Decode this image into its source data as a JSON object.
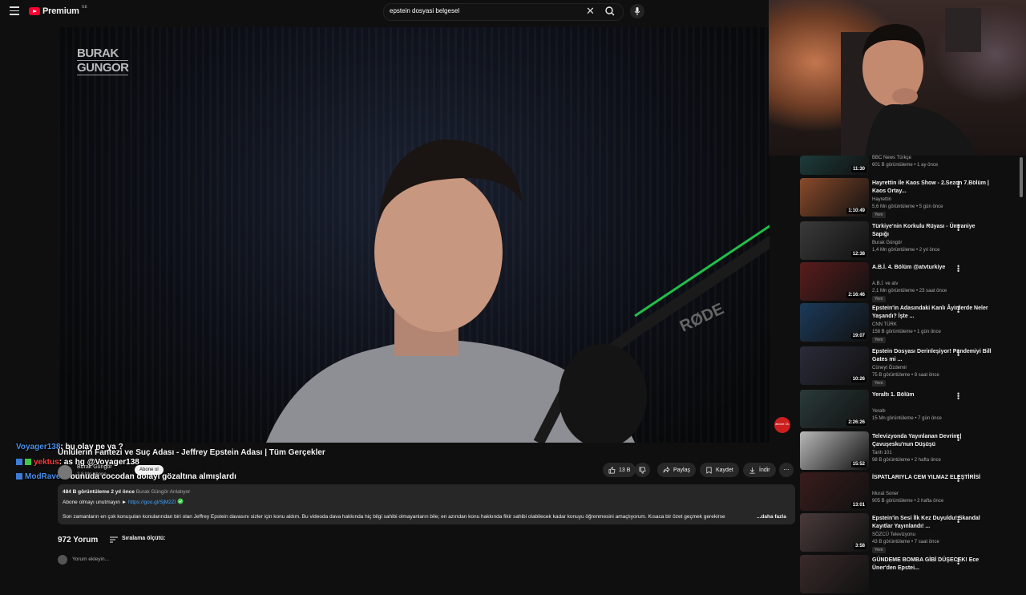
{
  "header": {
    "logo_text": "Premium",
    "logo_badge": "GE",
    "search_query": "epstein dosyasi belgesel",
    "icons": [
      "menu-icon",
      "youtube-logo-icon",
      "clear-icon",
      "search-icon",
      "mic-icon"
    ]
  },
  "player": {
    "watermark_line1": "BURAK",
    "watermark_line2": "GUNGOR",
    "overlay_badge": "abone OL"
  },
  "chat": [
    {
      "user": "Voyager138",
      "message": ": bu olay ne ya ?",
      "color": "#4a8fe7"
    },
    {
      "user": "yektus",
      "message": ": as hg @Voyager138",
      "color": "#ff3b3b"
    },
    {
      "user": "ModRaven",
      "message": ": bunuda cocodan dolayı gözaltına almışlardı",
      "color": "#4a8fe7"
    }
  ],
  "video": {
    "title": "Ünlülerin Fantezi ve Suç Adası - Jeffrey Epstein Adası | Tüm Gerçekler",
    "channel": "Burak Güngör",
    "subscribers": "2,8 Mn abone",
    "subscribe_label": "Abone ol",
    "likes": "13 B",
    "share_label": "Paylaş",
    "save_label": "Kaydet",
    "download_label": "İndir"
  },
  "description": {
    "views_date": "484 B görüntüleme  2 yıl önce",
    "hashtag": "Burak Güngör Anlatıyor",
    "subscribe_reminder": "Abone olmayı unutmayın ► ",
    "link": "https://goo.gl/SjM2ZI",
    "text": "Son zamanların en çok konuşulan konularından biri olan Jeffrey Epstein davasını sizler için konu aldım. Bu videoda dava hakkında hiç bilgi sahibi olmayanların bile; en azından konu hakkında fikir sahibi olabilecek kadar konuyu öğrenmesini amaçlıyorum. Kısaca bir özet geçmek gerekirse",
    "more_label": "...daha fazla"
  },
  "comments": {
    "count": "972 Yorum",
    "sort_label": "Sıralama ölçütü:",
    "input_placeholder": "Yorum ekleyin..."
  },
  "sidebar": {
    "items": [
      {
        "title": "",
        "channel": "BBC News Türkçe",
        "meta": "601 B görüntüleme • 1 ay önce",
        "badge": "",
        "duration": "11:30",
        "thumb": "#1d3b3a"
      },
      {
        "title": "Hayrettin ile Kaos Show - 2.Sezon 7.Bölüm | Kaos Ortay...",
        "channel": "Hayrettin",
        "meta": "5,6 Mn görüntüleme • 5 gün önce",
        "badge": "Yeni",
        "duration": "1:10:49",
        "thumb": "#8a4a2a"
      },
      {
        "title": "Türkiye'nin Korkulu Rüyası - Ümraniye Sapığı",
        "channel": "Burak Güngör",
        "meta": "1,4 Mn görüntüleme • 2 yıl önce",
        "badge": "",
        "duration": "12:38",
        "thumb": "#3a3a3a"
      },
      {
        "title": "A.B.İ. 4. Bölüm @atvturkiye",
        "channel": "A.B.İ. ve atv",
        "meta": "2,1 Mn görüntüleme • 23 saat önce",
        "badge": "Yeni",
        "duration": "2:16:46",
        "thumb": "#5a1c1c"
      },
      {
        "title": "Epstein'in Adasındaki Kanlı Âyinlerde Neler Yaşandı? İşte ...",
        "channel": "CNN TÜRK",
        "meta": "158 B görüntüleme • 1 gün önce",
        "badge": "Yeni",
        "duration": "19:07",
        "thumb": "#1c3a5a"
      },
      {
        "title": "Epstein Dosyası Derinleşiyor! Pandemiyi Bill Gates mi ...",
        "channel": "Cüneyt Özdemir",
        "meta": "75 B görüntüleme • 8 saat önce",
        "badge": "Yeni",
        "duration": "10:26",
        "thumb": "#2b2b3a"
      },
      {
        "title": "Yeraltı 1. Bölüm",
        "channel": "Yeraltı",
        "meta": "15 Mn görüntüleme • 7 gün önce",
        "badge": "",
        "duration": "2:26:26",
        "thumb": "#2a3a3a"
      },
      {
        "title": "Televizyonda Yayınlanan Devrim | Çavuşesku'nun Düşüşü",
        "channel": "Tarih 101",
        "meta": "98 B görüntüleme • 2 hafta önce",
        "badge": "",
        "duration": "15:52",
        "thumb": "#b8b8b8"
      },
      {
        "title": "İSPATLARIYLA CEM YILMAZ ELEŞTİRİSİ",
        "channel": "Murat Soner",
        "meta": "905 B görüntüleme • 2 hafta önce",
        "badge": "",
        "duration": "13:01",
        "thumb": "#3a1c1c"
      },
      {
        "title": "Epstein'in Sesi İlk Kez Duyuldu! Skandal Kayıtlar Yayınlandı! ...",
        "channel": "SÖZCÜ Televizyonu",
        "meta": "43 B görüntüleme • 7 saat önce",
        "badge": "Yeni",
        "duration": "3:58",
        "thumb": "#4a3a3a"
      },
      {
        "title": "GÜNDEME BOMBA GİBİ DÜŞECEK! Ece Üner'den Epstei...",
        "channel": "",
        "meta": "",
        "badge": "",
        "duration": "",
        "thumb": "#3a2a2a"
      }
    ]
  }
}
